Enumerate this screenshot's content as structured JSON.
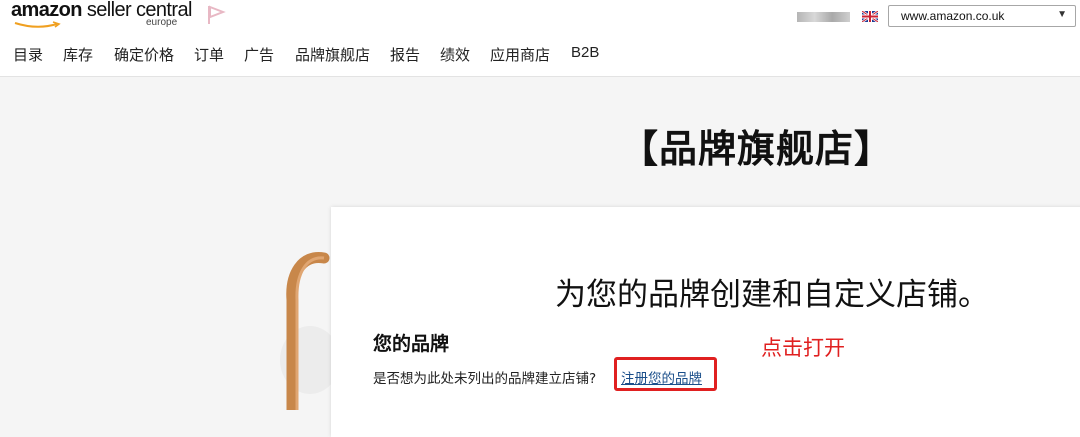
{
  "header": {
    "logo": {
      "brand": "amazon",
      "product": " seller central",
      "region": "europe"
    },
    "marketplace": {
      "selected": "www.amazon.co.uk"
    }
  },
  "nav": {
    "items": [
      {
        "label": "目录"
      },
      {
        "label": "库存"
      },
      {
        "label": "确定价格"
      },
      {
        "label": "订单"
      },
      {
        "label": "广告"
      },
      {
        "label": "品牌旗舰店"
      },
      {
        "label": "报告"
      },
      {
        "label": "绩效"
      },
      {
        "label": "应用商店"
      },
      {
        "label": "B2B"
      }
    ]
  },
  "main": {
    "heading": "【品牌旗舰店】",
    "card": {
      "title": "为您的品牌创建和自定义店铺。",
      "section_title": "您的品牌",
      "question": "是否想为此处未列出的品牌建立店铺?",
      "link_label": "注册您的品牌"
    },
    "annotation": "点击打开"
  },
  "colors": {
    "annotation_red": "#e02020",
    "link_blue": "#1a4e8a",
    "page_background": "#f5f5f5",
    "card_background": "#ffffff",
    "flag_pink": "#e8b8c4"
  },
  "icons": [
    "amazon-smile-icon",
    "flag-icon",
    "uk-flag-icon",
    "chevron-down-icon"
  ]
}
